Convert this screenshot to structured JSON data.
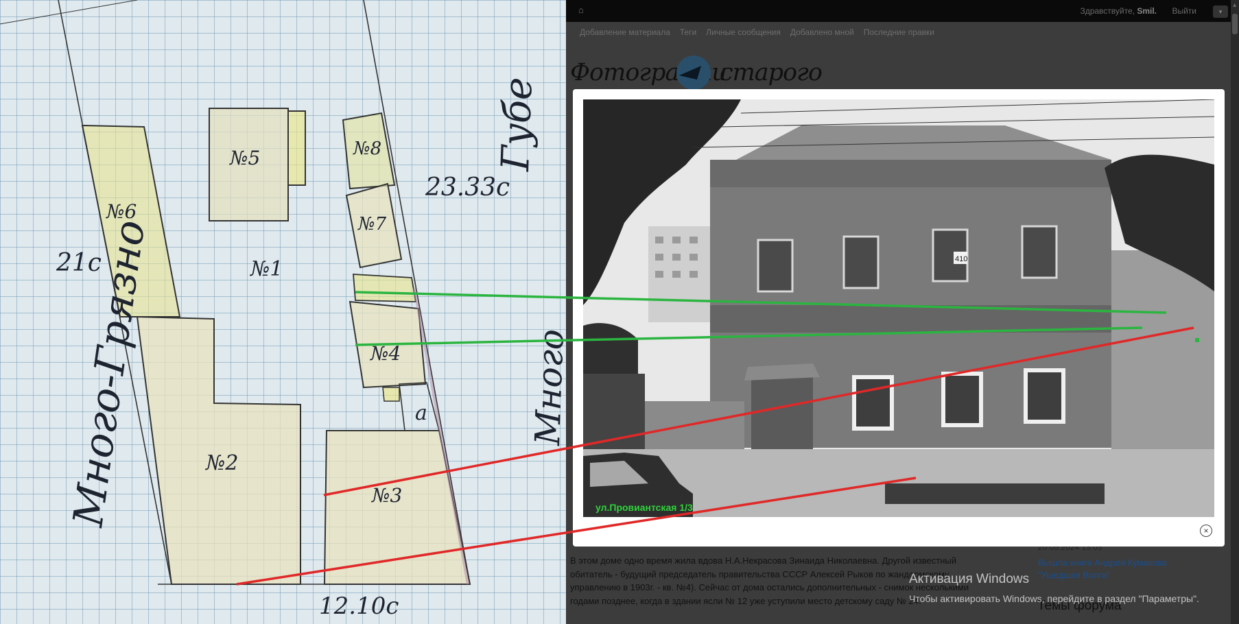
{
  "plan": {
    "labels": {
      "room5": "№5",
      "room6": "№6",
      "room8": "№8",
      "room7": "№7",
      "room1": "№1",
      "room4": "№4",
      "room2": "№2",
      "room3": "№3",
      "room_a": "а",
      "measure_left": "21с",
      "measure_right": "23.33с",
      "measure_bottom": "12.10с",
      "street_left": "Много-Грязно",
      "street_right": "Губе",
      "street_right2": "Много"
    }
  },
  "site": {
    "topbar": {
      "greeting_prefix": "Здравствуйте, ",
      "username": "Smil.",
      "logout_label": "Выйти"
    },
    "nav": [
      "Добавление материала",
      "Теги",
      "Личные сообщения",
      "Добавлено мной",
      "Последние правки"
    ],
    "logo": {
      "part1": "Фотографии",
      "part2": "старого Саратова"
    },
    "article_text": "В этом доме одно время жила вдова Н.А.Некрасова Зинаида Николаевна. Другой известный обитатель - будущий председатель правительства СССР Алексей Рыков по жандармскому управлению в 1903г. - кв. №4). Сейчас от дома остались дополнительных - снимок несколькими годами позднее, когда в здании ясли № 12 уже уступили место детскому саду № 24.",
    "sidebar": {
      "date": "20.05.2024 13:03",
      "link": "Вышла книга Андрея Кумакова \"Ушедшая Волга\"",
      "heading": "Темы форума"
    }
  },
  "lightbox": {
    "caption": "ул.Провиантская 1/3",
    "house_number": "410",
    "close_label": "×"
  },
  "watermark": {
    "title": "Активация Windows",
    "subtitle": "Чтобы активировать Windows, перейдите в раздел \"Параметры\"."
  }
}
